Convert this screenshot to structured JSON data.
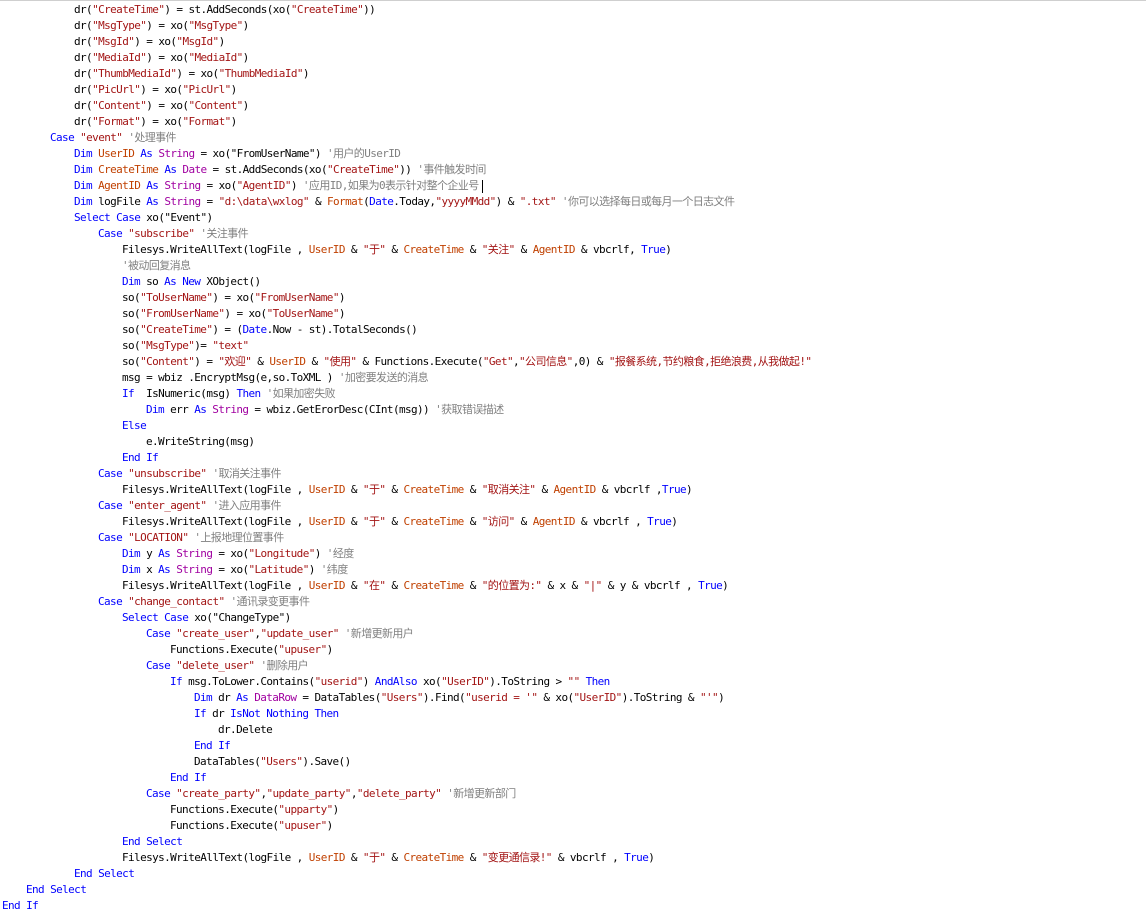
{
  "colors": {
    "n": "#000000",
    "k": "#0000ff",
    "s": "#a31515",
    "c": "#808080",
    "b": "#a000a0",
    "m": "#c04000"
  },
  "code_lines": [
    {
      "indent": 3,
      "tokens": [
        [
          "n",
          "dr("
        ],
        [
          "s",
          "\"CreateTime\""
        ],
        [
          "n",
          ") = st.AddSeconds(xo("
        ],
        [
          "s",
          "\"CreateTime\""
        ],
        [
          "n",
          "))"
        ]
      ]
    },
    {
      "indent": 3,
      "tokens": [
        [
          "n",
          "dr("
        ],
        [
          "s",
          "\"MsgType\""
        ],
        [
          "n",
          ") = xo("
        ],
        [
          "s",
          "\"MsgType\""
        ],
        [
          "n",
          ")"
        ]
      ]
    },
    {
      "indent": 3,
      "tokens": [
        [
          "n",
          "dr("
        ],
        [
          "s",
          "\"MsgId\""
        ],
        [
          "n",
          ") = xo("
        ],
        [
          "s",
          "\"MsgId\""
        ],
        [
          "n",
          ")"
        ]
      ]
    },
    {
      "indent": 3,
      "tokens": [
        [
          "n",
          "dr("
        ],
        [
          "s",
          "\"MediaId\""
        ],
        [
          "n",
          ") = xo("
        ],
        [
          "s",
          "\"MediaId\""
        ],
        [
          "n",
          ")"
        ]
      ]
    },
    {
      "indent": 3,
      "tokens": [
        [
          "n",
          "dr("
        ],
        [
          "s",
          "\"ThumbMediaId\""
        ],
        [
          "n",
          ") = xo("
        ],
        [
          "s",
          "\"ThumbMediaId\""
        ],
        [
          "n",
          ")"
        ]
      ]
    },
    {
      "indent": 3,
      "tokens": [
        [
          "n",
          "dr("
        ],
        [
          "s",
          "\"PicUrl\""
        ],
        [
          "n",
          ") = xo("
        ],
        [
          "s",
          "\"PicUrl\""
        ],
        [
          "n",
          ")"
        ]
      ]
    },
    {
      "indent": 3,
      "tokens": [
        [
          "n",
          "dr("
        ],
        [
          "s",
          "\"Content\""
        ],
        [
          "n",
          ") = xo("
        ],
        [
          "s",
          "\"Content\""
        ],
        [
          "n",
          ")"
        ]
      ]
    },
    {
      "indent": 3,
      "tokens": [
        [
          "n",
          "dr("
        ],
        [
          "s",
          "\"Format\""
        ],
        [
          "n",
          ") = xo("
        ],
        [
          "s",
          "\"Format\""
        ],
        [
          "n",
          ")"
        ]
      ]
    },
    {
      "indent": 2,
      "tokens": [
        [
          "k",
          "Case "
        ],
        [
          "s",
          "\"event\""
        ],
        [
          "c",
          " '处理事件"
        ]
      ]
    },
    {
      "indent": 3,
      "tokens": [
        [
          "k",
          "Dim "
        ],
        [
          "m",
          "UserID"
        ],
        [
          "k",
          " As "
        ],
        [
          "b",
          "String"
        ],
        [
          "n",
          " = xo(\"FromUserName\")"
        ],
        [
          "c",
          " '用户的UserID"
        ]
      ]
    },
    {
      "indent": 3,
      "tokens": [
        [
          "k",
          "Dim "
        ],
        [
          "m",
          "CreateTime"
        ],
        [
          "k",
          " As "
        ],
        [
          "b",
          "Date"
        ],
        [
          "n",
          " = st.AddSeconds(xo("
        ],
        [
          "s",
          "\"CreateTime\""
        ],
        [
          "n",
          "))"
        ],
        [
          "c",
          " '事件触发时间"
        ]
      ]
    },
    {
      "indent": 3,
      "tokens": [
        [
          "k",
          "Dim "
        ],
        [
          "m",
          "AgentID"
        ],
        [
          "k",
          " As "
        ],
        [
          "b",
          "String"
        ],
        [
          "n",
          " = xo("
        ],
        [
          "s",
          "\"AgentID\""
        ],
        [
          "n",
          ")"
        ],
        [
          "c",
          " '应用ID,如果为0表示针对整个企业号"
        ]
      ],
      "caret": true
    },
    {
      "indent": 3,
      "tokens": [
        [
          "k",
          "Dim "
        ],
        [
          "n",
          "logFile"
        ],
        [
          "k",
          " As "
        ],
        [
          "b",
          "String"
        ],
        [
          "n",
          " = "
        ],
        [
          "s",
          "\"d:\\data\\wxlog\""
        ],
        [
          "n",
          " & "
        ],
        [
          "m",
          "Format"
        ],
        [
          "n",
          "("
        ],
        [
          "k",
          "Date"
        ],
        [
          "n",
          ".Today,"
        ],
        [
          "s",
          "\"yyyyMMdd\""
        ],
        [
          "n",
          ") & "
        ],
        [
          "s",
          "\".txt\""
        ],
        [
          "c",
          " '你可以选择每日或每月一个日志文件"
        ]
      ]
    },
    {
      "indent": 3,
      "tokens": [
        [
          "k",
          "Select Case "
        ],
        [
          "n",
          "xo(\"Event\")"
        ]
      ]
    },
    {
      "indent": 4,
      "tokens": [
        [
          "k",
          "Case "
        ],
        [
          "s",
          "\"subscribe\""
        ],
        [
          "c",
          " '关注事件"
        ]
      ]
    },
    {
      "indent": 5,
      "tokens": [
        [
          "n",
          "Filesys.WriteAllText(logFile , "
        ],
        [
          "m",
          "UserID"
        ],
        [
          "n",
          " & "
        ],
        [
          "s",
          "\"于\""
        ],
        [
          "n",
          " & "
        ],
        [
          "m",
          "CreateTime"
        ],
        [
          "n",
          " & "
        ],
        [
          "s",
          "\"关注\""
        ],
        [
          "n",
          " & "
        ],
        [
          "m",
          "AgentID"
        ],
        [
          "n",
          " & vbcrlf, "
        ],
        [
          "k",
          "True"
        ],
        [
          "n",
          ")"
        ]
      ]
    },
    {
      "indent": 5,
      "tokens": [
        [
          "c",
          "'被动回复消息"
        ]
      ]
    },
    {
      "indent": 5,
      "tokens": [
        [
          "k",
          "Dim "
        ],
        [
          "n",
          "so"
        ],
        [
          "k",
          " As New "
        ],
        [
          "n",
          "XObject()"
        ]
      ]
    },
    {
      "indent": 5,
      "tokens": [
        [
          "n",
          "so("
        ],
        [
          "s",
          "\"ToUserName\""
        ],
        [
          "n",
          ") = xo("
        ],
        [
          "s",
          "\"FromUserName\""
        ],
        [
          "n",
          ")"
        ]
      ]
    },
    {
      "indent": 5,
      "tokens": [
        [
          "n",
          "so("
        ],
        [
          "s",
          "\"FromUserName\""
        ],
        [
          "n",
          ") = xo("
        ],
        [
          "s",
          "\"ToUserName\""
        ],
        [
          "n",
          ")"
        ]
      ]
    },
    {
      "indent": 5,
      "tokens": [
        [
          "n",
          "so("
        ],
        [
          "s",
          "\"CreateTime\""
        ],
        [
          "n",
          ") = ("
        ],
        [
          "k",
          "Date"
        ],
        [
          "n",
          ".Now - st).TotalSeconds()"
        ]
      ]
    },
    {
      "indent": 5,
      "tokens": [
        [
          "n",
          "so("
        ],
        [
          "s",
          "\"MsgType\""
        ],
        [
          "n",
          ")= "
        ],
        [
          "s",
          "\"text\""
        ]
      ]
    },
    {
      "indent": 5,
      "tokens": [
        [
          "n",
          "so("
        ],
        [
          "s",
          "\"Content\""
        ],
        [
          "n",
          ") = "
        ],
        [
          "s",
          "\"欢迎\""
        ],
        [
          "n",
          " & "
        ],
        [
          "m",
          "UserID"
        ],
        [
          "n",
          " & "
        ],
        [
          "s",
          "\"使用\""
        ],
        [
          "n",
          " & Functions.Execute("
        ],
        [
          "s",
          "\"Get\""
        ],
        [
          "n",
          ","
        ],
        [
          "s",
          "\"公司信息\""
        ],
        [
          "n",
          ",0) & "
        ],
        [
          "s",
          "\"报餐系统,节约粮食,拒绝浪费,从我做起!\""
        ]
      ]
    },
    {
      "indent": 5,
      "tokens": [
        [
          "n",
          "msg = wbiz .EncryptMsg(e,so.ToXML )"
        ],
        [
          "c",
          " '加密要发送的消息"
        ]
      ]
    },
    {
      "indent": 5,
      "tokens": [
        [
          "k",
          "If "
        ],
        [
          "n",
          " IsNumeric(msg) "
        ],
        [
          "k",
          "Then"
        ],
        [
          "c",
          " '如果加密失败"
        ]
      ]
    },
    {
      "indent": 6,
      "tokens": [
        [
          "k",
          "Dim "
        ],
        [
          "n",
          "err"
        ],
        [
          "k",
          " As "
        ],
        [
          "b",
          "String"
        ],
        [
          "n",
          " = wbiz.GetErorDesc(CInt(msg))"
        ],
        [
          "c",
          " '获取错误描述"
        ]
      ]
    },
    {
      "indent": 5,
      "tokens": [
        [
          "k",
          "Else"
        ]
      ]
    },
    {
      "indent": 6,
      "tokens": [
        [
          "n",
          "e.WriteString(msg)"
        ]
      ]
    },
    {
      "indent": 5,
      "tokens": [
        [
          "k",
          "End If"
        ]
      ]
    },
    {
      "indent": 4,
      "tokens": [
        [
          "k",
          "Case "
        ],
        [
          "s",
          "\"unsubscribe\""
        ],
        [
          "c",
          " '取消关注事件"
        ]
      ]
    },
    {
      "indent": 5,
      "tokens": [
        [
          "n",
          "Filesys.WriteAllText(logFile , "
        ],
        [
          "m",
          "UserID"
        ],
        [
          "n",
          " & "
        ],
        [
          "s",
          "\"于\""
        ],
        [
          "n",
          " & "
        ],
        [
          "m",
          "CreateTime"
        ],
        [
          "n",
          " & "
        ],
        [
          "s",
          "\"取消关注\""
        ],
        [
          "n",
          " & "
        ],
        [
          "m",
          "AgentID"
        ],
        [
          "n",
          " & vbcrlf ,"
        ],
        [
          "k",
          "True"
        ],
        [
          "n",
          ")"
        ]
      ]
    },
    {
      "indent": 4,
      "tokens": [
        [
          "k",
          "Case "
        ],
        [
          "s",
          "\"enter_agent\""
        ],
        [
          "c",
          " '进入应用事件"
        ]
      ]
    },
    {
      "indent": 5,
      "tokens": [
        [
          "n",
          "Filesys.WriteAllText(logFile , "
        ],
        [
          "m",
          "UserID"
        ],
        [
          "n",
          " & "
        ],
        [
          "s",
          "\"于\""
        ],
        [
          "n",
          " & "
        ],
        [
          "m",
          "CreateTime"
        ],
        [
          "n",
          " & "
        ],
        [
          "s",
          "\"访问\""
        ],
        [
          "n",
          " & "
        ],
        [
          "m",
          "AgentID"
        ],
        [
          "n",
          " & vbcrlf , "
        ],
        [
          "k",
          "True"
        ],
        [
          "n",
          ")"
        ]
      ]
    },
    {
      "indent": 4,
      "tokens": [
        [
          "k",
          "Case "
        ],
        [
          "s",
          "\"LOCATION\""
        ],
        [
          "c",
          " '上报地理位置事件"
        ]
      ]
    },
    {
      "indent": 5,
      "tokens": [
        [
          "k",
          "Dim "
        ],
        [
          "n",
          "y"
        ],
        [
          "k",
          " As "
        ],
        [
          "b",
          "String"
        ],
        [
          "n",
          " = xo("
        ],
        [
          "s",
          "\"Longitude\""
        ],
        [
          "n",
          ")"
        ],
        [
          "c",
          " '经度"
        ]
      ]
    },
    {
      "indent": 5,
      "tokens": [
        [
          "k",
          "Dim "
        ],
        [
          "n",
          "x"
        ],
        [
          "k",
          " As "
        ],
        [
          "b",
          "String"
        ],
        [
          "n",
          " = xo("
        ],
        [
          "s",
          "\"Latitude\""
        ],
        [
          "n",
          ")"
        ],
        [
          "c",
          " '纬度"
        ]
      ]
    },
    {
      "indent": 5,
      "tokens": [
        [
          "n",
          "Filesys.WriteAllText(logFile , "
        ],
        [
          "m",
          "UserID"
        ],
        [
          "n",
          " & "
        ],
        [
          "s",
          "\"在\""
        ],
        [
          "n",
          " & "
        ],
        [
          "m",
          "CreateTime"
        ],
        [
          "n",
          " & "
        ],
        [
          "s",
          "\"的位置为:\""
        ],
        [
          "n",
          " & x & "
        ],
        [
          "s",
          "\"|\""
        ],
        [
          "n",
          " & y & vbcrlf , "
        ],
        [
          "k",
          "True"
        ],
        [
          "n",
          ")"
        ]
      ]
    },
    {
      "indent": 4,
      "tokens": [
        [
          "k",
          "Case "
        ],
        [
          "s",
          "\"change_contact\""
        ],
        [
          "c",
          " '通讯录变更事件"
        ]
      ]
    },
    {
      "indent": 5,
      "tokens": [
        [
          "k",
          "Select Case "
        ],
        [
          "n",
          "xo(\"ChangeType\")"
        ]
      ]
    },
    {
      "indent": 6,
      "tokens": [
        [
          "k",
          "Case "
        ],
        [
          "s",
          "\"create_user\""
        ],
        [
          "n",
          ","
        ],
        [
          "s",
          "\"update_user\""
        ],
        [
          "c",
          " '新增更新用户"
        ]
      ]
    },
    {
      "indent": 7,
      "tokens": [
        [
          "n",
          "Functions.Execute("
        ],
        [
          "s",
          "\"upuser\""
        ],
        [
          "n",
          ")"
        ]
      ]
    },
    {
      "indent": 6,
      "tokens": [
        [
          "k",
          "Case "
        ],
        [
          "s",
          "\"delete_user\""
        ],
        [
          "c",
          " '删除用户"
        ]
      ]
    },
    {
      "indent": 7,
      "tokens": [
        [
          "k",
          "If "
        ],
        [
          "n",
          "msg.ToLower.Contains("
        ],
        [
          "s",
          "\"userid\""
        ],
        [
          "n",
          ") "
        ],
        [
          "k",
          "AndAlso "
        ],
        [
          "n",
          "xo("
        ],
        [
          "s",
          "\"UserID\""
        ],
        [
          "n",
          ").ToString > "
        ],
        [
          "s",
          "\"\""
        ],
        [
          "k",
          " Then"
        ]
      ]
    },
    {
      "indent": 8,
      "tokens": [
        [
          "k",
          "Dim "
        ],
        [
          "n",
          "dr"
        ],
        [
          "k",
          " As "
        ],
        [
          "b",
          "DataRow"
        ],
        [
          "n",
          " = DataTables("
        ],
        [
          "s",
          "\"Users\""
        ],
        [
          "n",
          ").Find("
        ],
        [
          "s",
          "\"userid = '\""
        ],
        [
          "n",
          " & xo("
        ],
        [
          "s",
          "\"UserID\""
        ],
        [
          "n",
          ").ToString & "
        ],
        [
          "s",
          "\"'\""
        ],
        [
          "n",
          ")"
        ]
      ]
    },
    {
      "indent": 8,
      "tokens": [
        [
          "k",
          "If "
        ],
        [
          "n",
          "dr"
        ],
        [
          "k",
          " IsNot Nothing Then"
        ]
      ]
    },
    {
      "indent": 9,
      "tokens": [
        [
          "n",
          "dr.Delete"
        ]
      ]
    },
    {
      "indent": 8,
      "tokens": [
        [
          "k",
          "End If"
        ]
      ]
    },
    {
      "indent": 8,
      "tokens": [
        [
          "n",
          "DataTables("
        ],
        [
          "s",
          "\"Users\""
        ],
        [
          "n",
          ").Save()"
        ]
      ]
    },
    {
      "indent": 7,
      "tokens": [
        [
          "k",
          "End If"
        ]
      ]
    },
    {
      "indent": 6,
      "tokens": [
        [
          "k",
          "Case "
        ],
        [
          "s",
          "\"create_party\""
        ],
        [
          "n",
          ","
        ],
        [
          "s",
          "\"update_party\""
        ],
        [
          "n",
          ","
        ],
        [
          "s",
          "\"delete_party\""
        ],
        [
          "c",
          " '新增更新部门"
        ]
      ]
    },
    {
      "indent": 7,
      "tokens": [
        [
          "n",
          "Functions.Execute("
        ],
        [
          "s",
          "\"upparty\""
        ],
        [
          "n",
          ")"
        ]
      ]
    },
    {
      "indent": 7,
      "tokens": [
        [
          "n",
          "Functions.Execute("
        ],
        [
          "s",
          "\"upuser\""
        ],
        [
          "n",
          ")"
        ]
      ]
    },
    {
      "indent": 5,
      "tokens": [
        [
          "k",
          "End Select"
        ]
      ]
    },
    {
      "indent": 5,
      "tokens": [
        [
          "n",
          "Filesys.WriteAllText(logFile , "
        ],
        [
          "m",
          "UserID"
        ],
        [
          "n",
          " & "
        ],
        [
          "s",
          "\"于\""
        ],
        [
          "n",
          " & "
        ],
        [
          "m",
          "CreateTime"
        ],
        [
          "n",
          " & "
        ],
        [
          "s",
          "\"变更通信录!\""
        ],
        [
          "n",
          " & vbcrlf , "
        ],
        [
          "k",
          "True"
        ],
        [
          "n",
          ")"
        ]
      ]
    },
    {
      "indent": 3,
      "tokens": [
        [
          "k",
          "End Select"
        ]
      ]
    },
    {
      "indent": 1,
      "tokens": [
        [
          "k",
          "End Select"
        ]
      ]
    },
    {
      "indent": 0,
      "tokens": [
        [
          "k",
          "End If"
        ]
      ]
    }
  ]
}
